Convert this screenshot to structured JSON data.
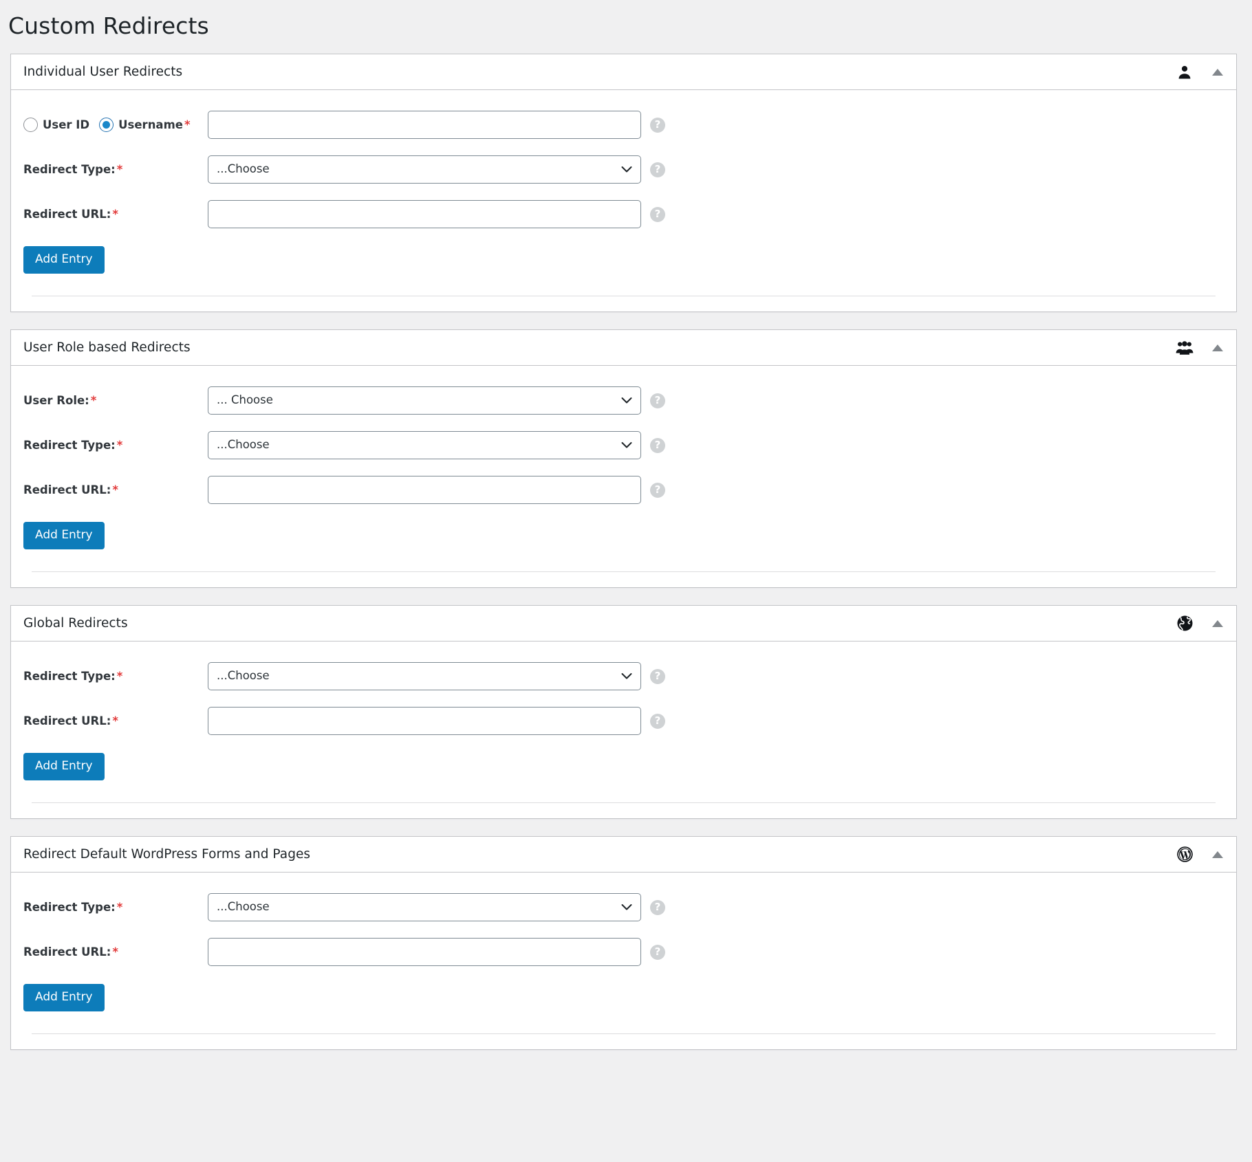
{
  "page": {
    "title": "Custom Redirects"
  },
  "common": {
    "required_mark": "*",
    "help_icon_glyph": "?",
    "add_entry_label": "Add Entry",
    "redirect_type_label": "Redirect Type:",
    "redirect_url_label": "Redirect URL:",
    "choose_placeholder": "...Choose",
    "accent_blue": "#0d7cba",
    "required_red": "#e23b3b",
    "panel_bg": "#ffffff",
    "page_bg": "#f0f0f1"
  },
  "panels": [
    {
      "id": "individual-user-redirects",
      "title": "Individual User Redirects",
      "icon": "single-user-icon",
      "toggle": "collapse-arrow-up-icon",
      "radio_group": {
        "options": [
          {
            "label": "User ID",
            "selected": false
          },
          {
            "label": "Username",
            "selected": true
          }
        ],
        "required": "*"
      },
      "fields": [
        {
          "kind": "text",
          "name": "username-input",
          "value": "",
          "placeholder": ""
        },
        {
          "kind": "select",
          "name": "redirect-type-select",
          "label": "Redirect Type:",
          "value": "...Choose",
          "required": "*"
        },
        {
          "kind": "text",
          "name": "redirect-url-input",
          "label": "Redirect URL:",
          "value": "",
          "placeholder": "",
          "required": "*"
        }
      ],
      "button": "Add Entry"
    },
    {
      "id": "user-role-based-redirects",
      "title": "User Role based Redirects",
      "icon": "group-users-icon",
      "toggle": "collapse-arrow-up-icon",
      "fields": [
        {
          "kind": "select",
          "name": "user-role-select",
          "label": "User Role:",
          "value": "... Choose",
          "required": "*"
        },
        {
          "kind": "select",
          "name": "redirect-type-select",
          "label": "Redirect Type:",
          "value": "...Choose",
          "required": "*"
        },
        {
          "kind": "text",
          "name": "redirect-url-input",
          "label": "Redirect URL:",
          "value": "",
          "placeholder": "",
          "required": "*"
        }
      ],
      "button": "Add Entry"
    },
    {
      "id": "global-redirects",
      "title": "Global Redirects",
      "icon": "globe-icon",
      "toggle": "collapse-arrow-up-icon",
      "fields": [
        {
          "kind": "select",
          "name": "redirect-type-select",
          "label": "Redirect Type:",
          "value": "...Choose",
          "required": "*"
        },
        {
          "kind": "text",
          "name": "redirect-url-input",
          "label": "Redirect URL:",
          "value": "",
          "placeholder": "",
          "required": "*"
        }
      ],
      "button": "Add Entry"
    },
    {
      "id": "redirect-default-wordpress-forms-and-pages",
      "title": "Redirect Default WordPress Forms and Pages",
      "icon": "wordpress-logo-icon",
      "toggle": "collapse-arrow-up-icon",
      "fields": [
        {
          "kind": "select",
          "name": "redirect-type-select",
          "label": "Redirect Type:",
          "value": "...Choose",
          "required": "*"
        },
        {
          "kind": "text",
          "name": "redirect-url-input",
          "label": "Redirect URL:",
          "value": "",
          "placeholder": "",
          "required": "*"
        }
      ],
      "button": "Add Entry"
    }
  ]
}
